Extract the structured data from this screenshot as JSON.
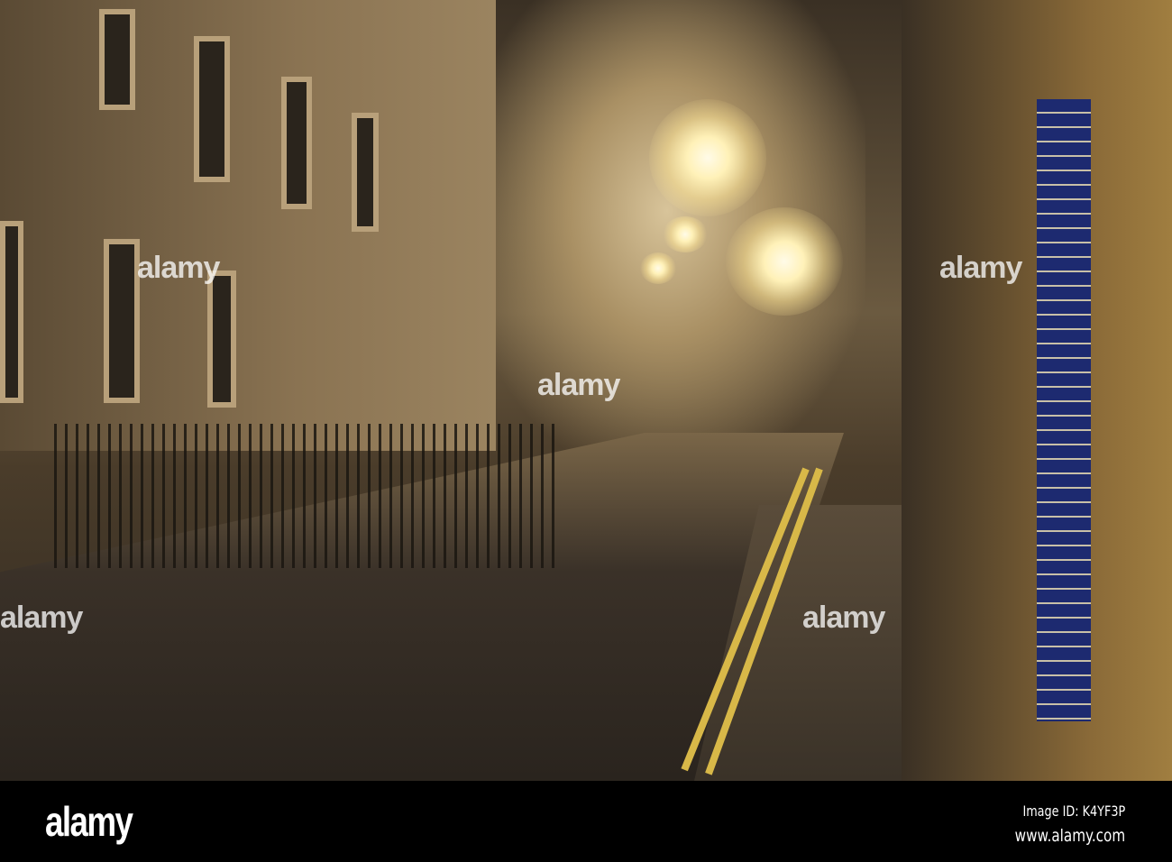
{
  "watermark": {
    "text": "alamy"
  },
  "footer": {
    "logo": "alamy",
    "image_id": "Image ID: K4YF3P",
    "url": "www.alamy.com"
  }
}
